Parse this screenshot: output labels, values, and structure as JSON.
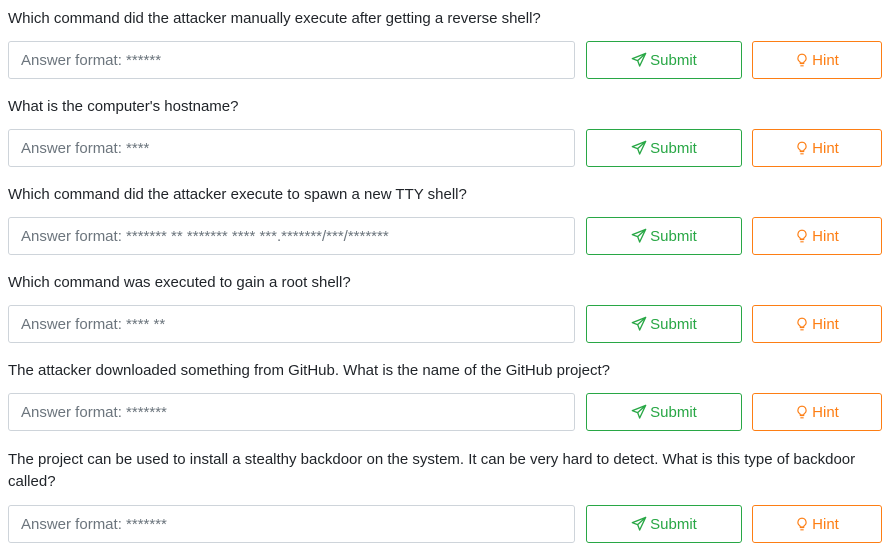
{
  "buttons": {
    "submit": "Submit",
    "hint": "Hint"
  },
  "icons": {
    "submit": "paper-plane-icon",
    "hint": "lightbulb-icon"
  },
  "colors": {
    "submit": "#28a745",
    "hint": "#fd7e14"
  },
  "questions": [
    {
      "text": "Which command did the attacker manually execute after getting a reverse shell?",
      "placeholder": "Answer format: ******"
    },
    {
      "text": "What is the computer's hostname?",
      "placeholder": "Answer format: ****"
    },
    {
      "text": "Which command did the attacker execute to spawn a new TTY shell?",
      "placeholder": "Answer format: ******* ** ******* **** ***.*******/***/*******"
    },
    {
      "text": "Which command was executed to gain a root shell?",
      "placeholder": "Answer format: **** **"
    },
    {
      "text": "The attacker downloaded something from GitHub. What is the name of the GitHub project?",
      "placeholder": "Answer format: *******"
    },
    {
      "text": "The project can be used to install a stealthy backdoor on the system. It can be very hard to detect. What is this type of backdoor called?",
      "placeholder": "Answer format: *******"
    }
  ]
}
